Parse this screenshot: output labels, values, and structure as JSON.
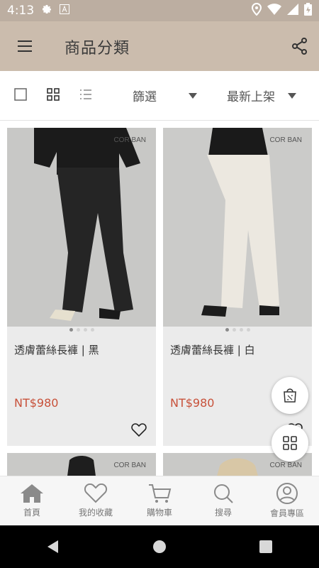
{
  "status": {
    "time": "4:13"
  },
  "appbar": {
    "title": "商品分類"
  },
  "toolbar": {
    "filter_label": "篩選",
    "sort_label": "最新上架"
  },
  "products": [
    {
      "name": "透膚蕾絲長褲 | 黑",
      "price": "NT$980",
      "brand": "COR BAN"
    },
    {
      "name": "透膚蕾絲長褲 | 白",
      "price": "NT$980",
      "brand": "COR BAN"
    },
    {
      "brand": "COR BAN"
    },
    {
      "brand": "COR BAN"
    }
  ],
  "nav": [
    {
      "label": "首頁",
      "icon": "home-icon"
    },
    {
      "label": "我的收藏",
      "icon": "heart-icon"
    },
    {
      "label": "購物車",
      "icon": "cart-icon"
    },
    {
      "label": "搜尋",
      "icon": "search-icon"
    },
    {
      "label": "會員專區",
      "icon": "user-icon"
    }
  ],
  "colors": {
    "header": "#cbbcad",
    "statusbar": "#bcaea1",
    "price": "#c8513a"
  }
}
